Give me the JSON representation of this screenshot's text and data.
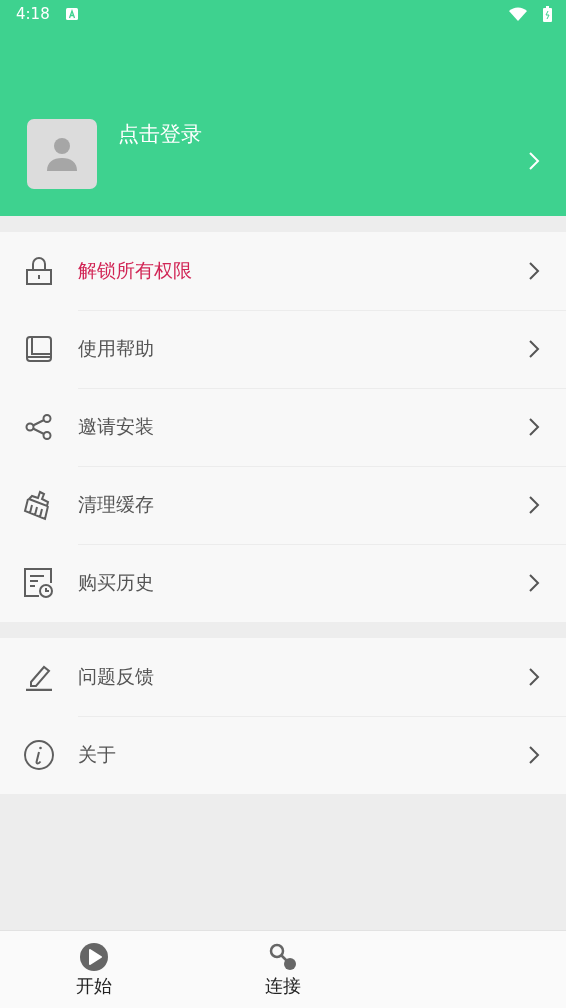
{
  "status_bar": {
    "time": "4:18"
  },
  "profile": {
    "login_label": "点击登录"
  },
  "sections": [
    {
      "items": [
        {
          "label": "解锁所有权限",
          "highlighted": true
        },
        {
          "label": "使用帮助",
          "highlighted": false
        },
        {
          "label": "邀请安装",
          "highlighted": false
        },
        {
          "label": "清理缓存",
          "highlighted": false
        },
        {
          "label": "购买历史",
          "highlighted": false
        }
      ]
    },
    {
      "items": [
        {
          "label": "问题反馈",
          "highlighted": false
        },
        {
          "label": "关于",
          "highlighted": false
        }
      ]
    }
  ],
  "bottom_nav": [
    {
      "label": "开始"
    },
    {
      "label": "连接"
    }
  ]
}
